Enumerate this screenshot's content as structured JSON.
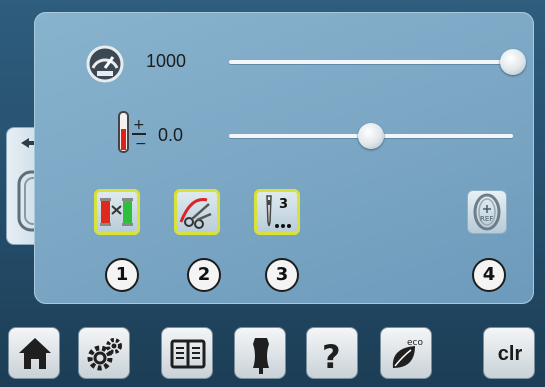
{
  "settings": {
    "speed_value": "1000",
    "speed_level": 1.0,
    "tension_value": "0.0",
    "tension_level": 0.5
  },
  "functions": [
    {
      "number": "1",
      "icon": "thread-cutter-colors-icon"
    },
    {
      "number": "2",
      "icon": "thread-cut-scissors-icon"
    },
    {
      "number": "3",
      "icon": "stitch-count-needle-icon",
      "label": "3"
    },
    {
      "number": "4",
      "icon": "hoop-ref-icon",
      "label": "REF"
    }
  ],
  "bottom_nav": {
    "icons": [
      "home-icon",
      "setup-gears-icon",
      "tutorial-book-icon",
      "creative-consultant-icon",
      "help-icon",
      "eco-icon"
    ],
    "clr_label": "clr",
    "eco_label": "eco"
  },
  "colors": {
    "highlight_border": "#d8e23a",
    "panel": "#7ea9c6",
    "background": "#244c68"
  }
}
